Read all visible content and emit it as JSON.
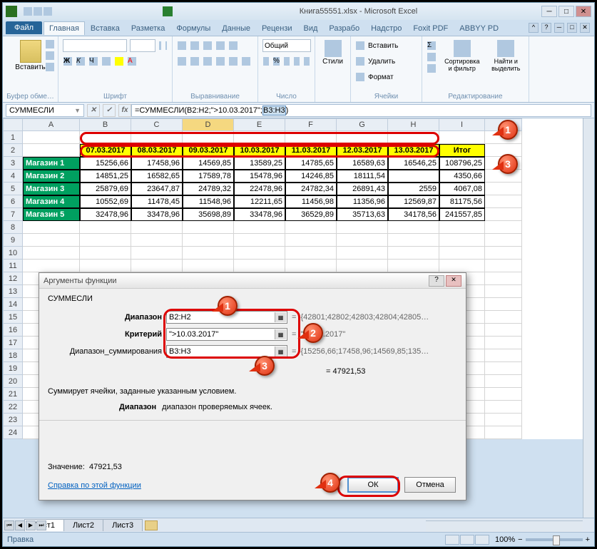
{
  "title": "Книга55551.xlsx - Microsoft Excel",
  "file_tab": "Файл",
  "tabs": [
    "Главная",
    "Вставка",
    "Разметка",
    "Формулы",
    "Данные",
    "Рецензи",
    "Вид",
    "Разрабо",
    "Надстро",
    "Foxit PDF",
    "ABBYY PD"
  ],
  "ribbon_groups": {
    "clipboard": "Буфер обме…",
    "paste": "Вставить",
    "font": "Шрифт",
    "align": "Выравнивание",
    "number": "Число",
    "number_format": "Общий",
    "styles": "Стили",
    "cells": "Ячейки",
    "cells_insert": "Вставить",
    "cells_delete": "Удалить",
    "cells_format": "Формат",
    "editing": "Редактирование",
    "sort": "Сортировка и фильтр",
    "find": "Найти и выделить"
  },
  "name_box": "СУММЕСЛИ",
  "formula": "=СУММЕСЛИ(B2:H2;\">10.03.2017\";B3:H3)",
  "cols": [
    "A",
    "B",
    "C",
    "D",
    "E",
    "F",
    "G",
    "H",
    "I",
    "J"
  ],
  "dates": [
    "07.03.2017",
    "08.03.2017",
    "09.03.2017",
    "10.03.2017",
    "11.03.2017",
    "12.03.2017",
    "13.03.2017"
  ],
  "itog": "Итог",
  "shops": [
    "Магазин 1",
    "Магазин 2",
    "Магазин 3",
    "Магазин 4",
    "Магазин 5"
  ],
  "data": [
    [
      "15256,66",
      "17458,96",
      "14569,85",
      "13589,25",
      "14785,65",
      "16589,63",
      "16546,25",
      "108796,25"
    ],
    [
      "14851,25",
      "16582,65",
      "17589,78",
      "15478,96",
      "14246,85",
      "18111,54",
      "",
      "4350,66"
    ],
    [
      "25879,69",
      "23647,87",
      "24789,32",
      "22478,96",
      "24782,34",
      "26891,43",
      "2559",
      "4067,08"
    ],
    [
      "10552,69",
      "11478,45",
      "11548,96",
      "12211,65",
      "11456,98",
      "11356,96",
      "12569,87",
      "81175,56"
    ],
    [
      "32478,96",
      "33478,96",
      "35698,89",
      "33478,96",
      "36529,89",
      "35713,63",
      "34178,56",
      "241557,85"
    ]
  ],
  "dialog": {
    "title": "Аргументы функции",
    "func": "СУММЕСЛИ",
    "args": [
      {
        "label": "Диапазон",
        "value": "B2:H2",
        "result": "{42801;42802;42803;42804;42805…"
      },
      {
        "label": "Критерий",
        "value": "\">10.03.2017\"",
        "result": "\"10.03.2017\""
      },
      {
        "label": "Диапазон_суммирования",
        "value": "B3:H3",
        "result": "{15256,66;17458,96;14569,85;135…"
      }
    ],
    "eq_result": "= 47921,53",
    "desc": "Суммирует ячейки, заданные указанным условием.",
    "param_name": "Диапазон",
    "param_desc": "диапазон проверяемых ячеек.",
    "value_label": "Значение:",
    "value": "47921,53",
    "link": "Справка по этой функции",
    "ok": "ОК",
    "cancel": "Отмена"
  },
  "sheets": [
    "Лист1",
    "Лист2",
    "Лист3"
  ],
  "status": "Правка",
  "zoom": "100%",
  "callouts": {
    "c1": "1",
    "c2": "2",
    "c3": "3",
    "c4": "4"
  }
}
